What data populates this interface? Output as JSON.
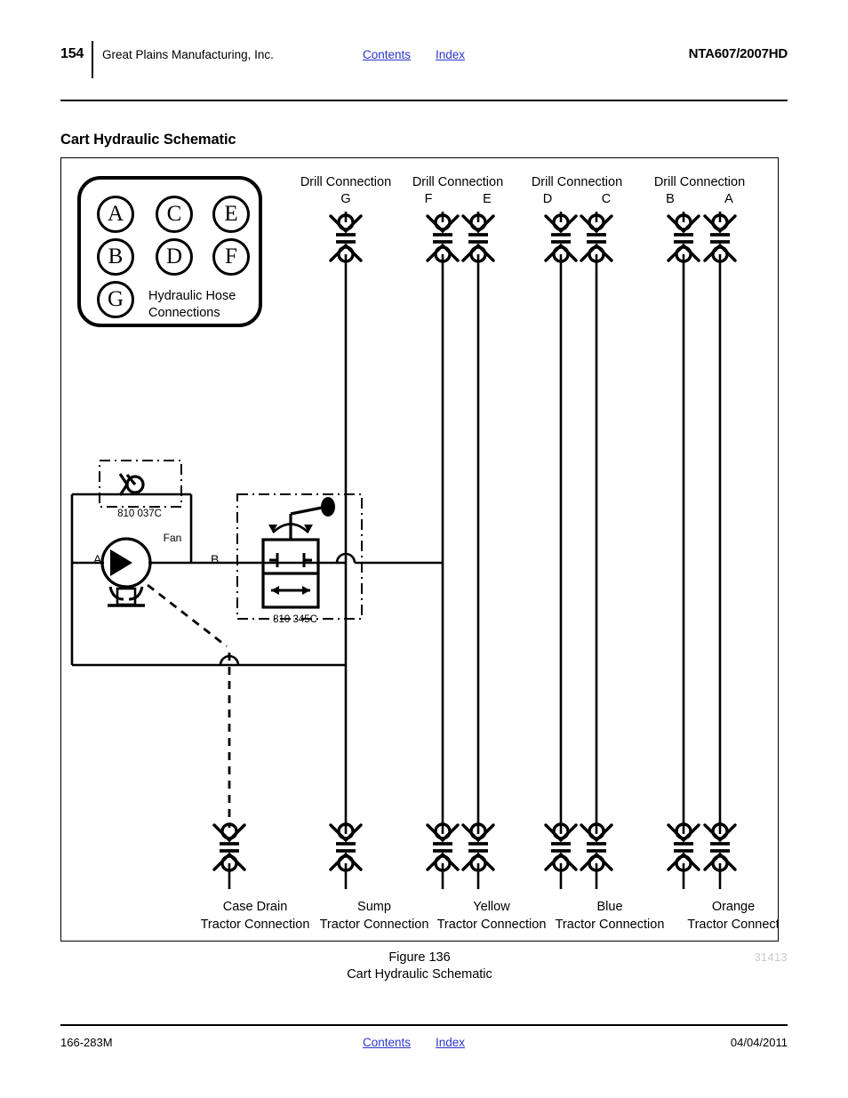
{
  "header": {
    "page_number": "154",
    "company": "Great Plains Manufacturing, Inc.",
    "contents_link": "Contents",
    "index_link": "Index",
    "model": "NTA607/2007HD"
  },
  "section": {
    "title": "Cart Hydraulic Schematic"
  },
  "legend": {
    "circles": [
      "A",
      "C",
      "E",
      "B",
      "D",
      "F",
      "G"
    ],
    "caption": "Hydraulic Hose\nConnections"
  },
  "drill_connections": [
    {
      "title": "Drill  Connection",
      "ports": [
        "G"
      ]
    },
    {
      "title": "Drill  Connection",
      "ports": [
        "F",
        "E"
      ]
    },
    {
      "title": "Drill  Connection",
      "ports": [
        "D",
        "C"
      ]
    },
    {
      "title": "Drill  Connection",
      "ports": [
        "B",
        "A"
      ]
    }
  ],
  "tractor_connections": [
    {
      "name": "Case Drain",
      "sub": "Tractor  Connection"
    },
    {
      "name": "Sump",
      "sub": "Tractor  Connection"
    },
    {
      "name": "Yellow",
      "sub": "Tractor  Connection"
    },
    {
      "name": "Blue",
      "sub": "Tractor  Connection"
    },
    {
      "name": "Orange",
      "sub": "Tractor  Connect"
    }
  ],
  "components": {
    "check_valve_part": "810 037C",
    "directional_valve_part": "810 345C",
    "fan_label": "Fan",
    "fan_port_a": "A",
    "fan_port_b": "B"
  },
  "figure": {
    "number": "Figure 136",
    "caption": "Cart Hydraulic Schematic",
    "image_id": "31413"
  },
  "footer": {
    "document": "166-283M",
    "contents_link": "Contents",
    "index_link": "Index",
    "date": "04/04/2011"
  },
  "colors": {
    "link": "#2a36c8",
    "line": "#000000",
    "figure_id": "#c9c9c9"
  }
}
